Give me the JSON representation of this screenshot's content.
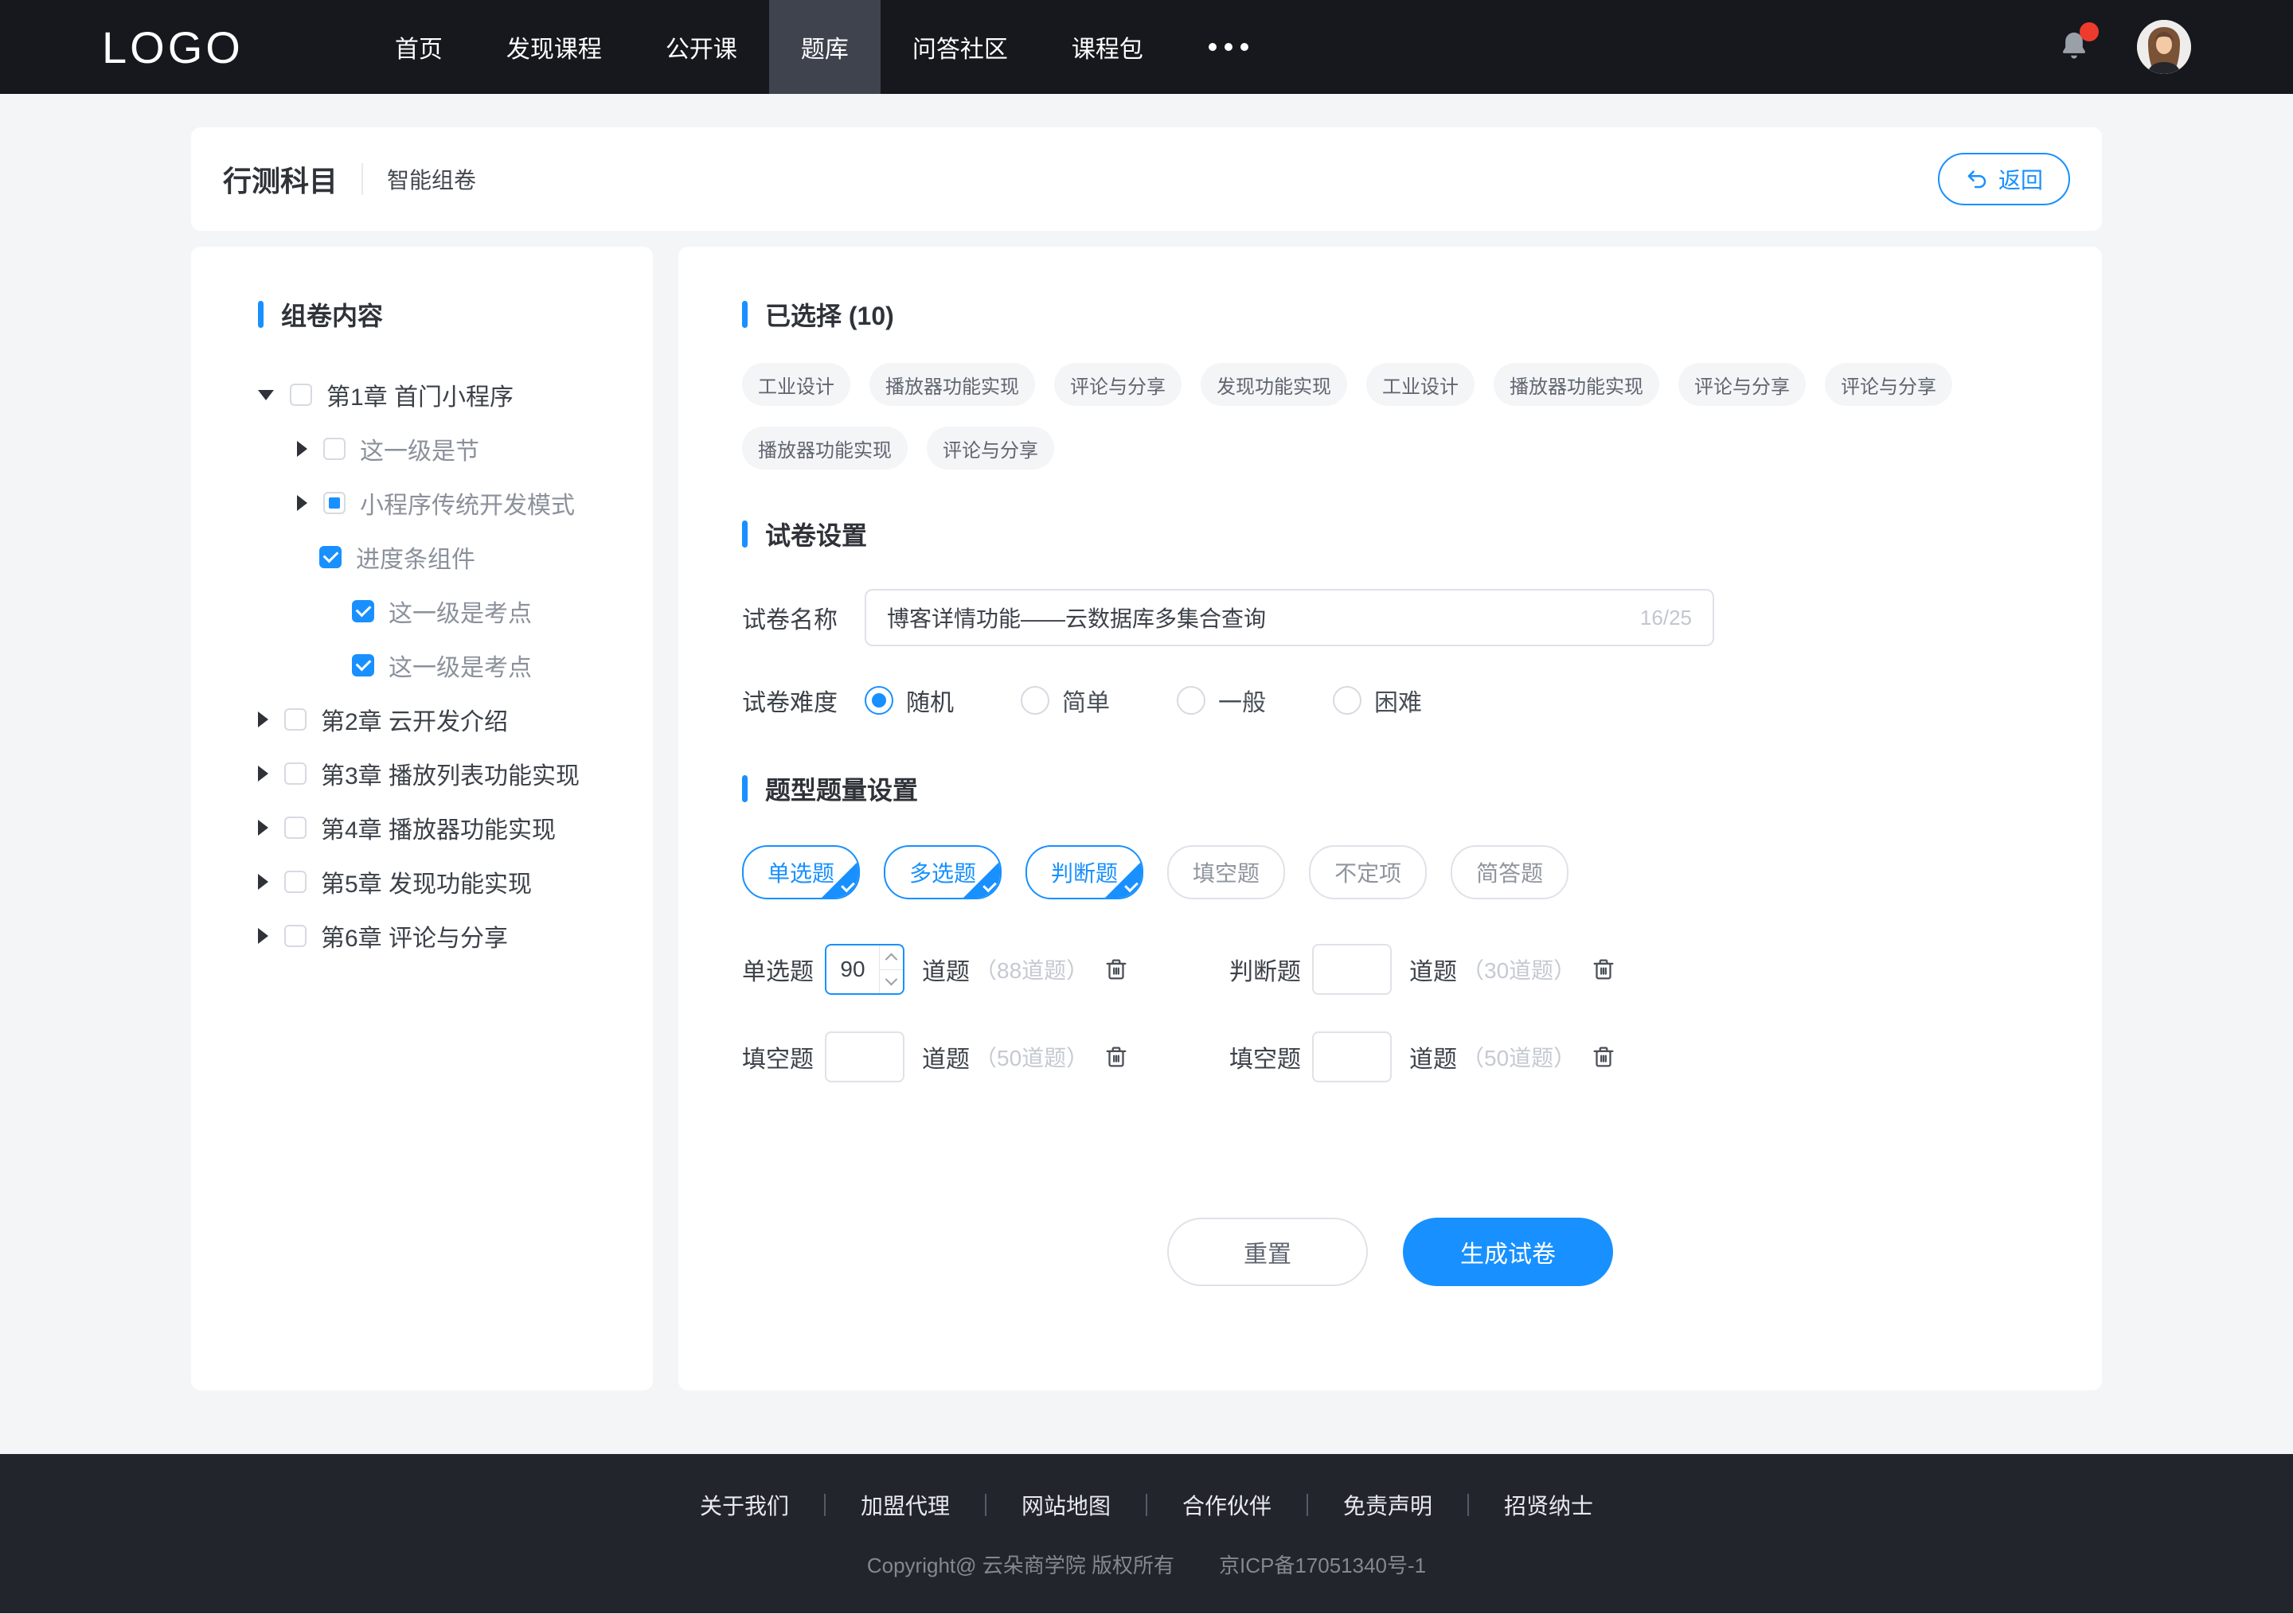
{
  "nav": {
    "logo": "LOGO",
    "items": [
      {
        "label": "首页"
      },
      {
        "label": "发现课程"
      },
      {
        "label": "公开课"
      },
      {
        "label": "题库",
        "active": true
      },
      {
        "label": "问答社区"
      },
      {
        "label": "课程包"
      }
    ],
    "more_icon": "ellipsis",
    "notification": {
      "has_unread": true
    }
  },
  "header": {
    "title": "行测科目",
    "subtitle": "智能组卷",
    "back_label": "返回"
  },
  "sidebar": {
    "title": "组卷内容",
    "tree": [
      {
        "label": "第1章 首门小程序",
        "level": 1,
        "caret": "down",
        "checkbox": "unchecked"
      },
      {
        "label": "这一级是节",
        "level": 2,
        "caret": "right",
        "checkbox": "unchecked"
      },
      {
        "label": "小程序传统开发模式",
        "level": 2,
        "caret": "right",
        "checkbox": "indeterminate"
      },
      {
        "label": "进度条组件",
        "level": 3,
        "caret": "none",
        "checkbox": "checked"
      },
      {
        "label": "这一级是考点",
        "level": 4,
        "caret": "none",
        "checkbox": "checked"
      },
      {
        "label": "这一级是考点",
        "level": 4,
        "caret": "none",
        "checkbox": "checked"
      },
      {
        "label": "第2章 云开发介绍",
        "level": 1,
        "caret": "right",
        "checkbox": "unchecked"
      },
      {
        "label": "第3章 播放列表功能实现",
        "level": 1,
        "caret": "right",
        "checkbox": "unchecked"
      },
      {
        "label": "第4章 播放器功能实现",
        "level": 1,
        "caret": "right",
        "checkbox": "unchecked"
      },
      {
        "label": "第5章 发现功能实现",
        "level": 1,
        "caret": "right",
        "checkbox": "unchecked"
      },
      {
        "label": "第6章 评论与分享",
        "level": 1,
        "caret": "right",
        "checkbox": "unchecked"
      }
    ]
  },
  "selected": {
    "title": "已选择 (10)",
    "tags": [
      "工业设计",
      "播放器功能实现",
      "评论与分享",
      "发现功能实现",
      "工业设计",
      "播放器功能实现",
      "评论与分享",
      "评论与分享",
      "播放器功能实现",
      "评论与分享"
    ]
  },
  "paper_settings": {
    "title": "试卷设置",
    "name_label": "试卷名称",
    "name_value": "博客详情功能——云数据库多集合查询",
    "name_counter": "16/25",
    "difficulty_label": "试卷难度",
    "difficulty_options": [
      {
        "label": "随机",
        "selected": true
      },
      {
        "label": "简单",
        "selected": false
      },
      {
        "label": "一般",
        "selected": false
      },
      {
        "label": "困难",
        "selected": false
      }
    ]
  },
  "question_settings": {
    "title": "题型题量设置",
    "types": [
      {
        "label": "单选题",
        "selected": true
      },
      {
        "label": "多选题",
        "selected": true
      },
      {
        "label": "判断题",
        "selected": true
      },
      {
        "label": "填空题",
        "selected": false
      },
      {
        "label": "不定项",
        "selected": false
      },
      {
        "label": "简答题",
        "selected": false
      }
    ],
    "quantities": [
      {
        "label": "单选题",
        "value": "90",
        "unit": "道题",
        "available": "（88道题）",
        "focused": true
      },
      {
        "label": "判断题",
        "value": "",
        "unit": "道题",
        "available": "（30道题）",
        "focused": false
      },
      {
        "label": "填空题",
        "value": "",
        "unit": "道题",
        "available": "（50道题）",
        "focused": false
      },
      {
        "label": "填空题",
        "value": "",
        "unit": "道题",
        "available": "（50道题）",
        "focused": false
      }
    ]
  },
  "actions": {
    "reset": "重置",
    "generate": "生成试卷"
  },
  "footer": {
    "links": [
      "关于我们",
      "加盟代理",
      "网站地图",
      "合作伙伴",
      "免责声明",
      "招贤纳士"
    ],
    "copyright_parts": [
      "Copyright@ 云朵商学院  版权所有",
      "京ICP备17051340号-1"
    ]
  },
  "colors": {
    "accent": "#1890ff",
    "nav_bg": "#16181d",
    "nav_active_bg": "#3e434d",
    "page_bg": "#f4f5f7",
    "footer_bg": "#22252c",
    "badge_red": "#ef3b2d",
    "muted_text": "#8b919b",
    "light_text": "#c5c9d1",
    "border": "#dfe2e8"
  }
}
